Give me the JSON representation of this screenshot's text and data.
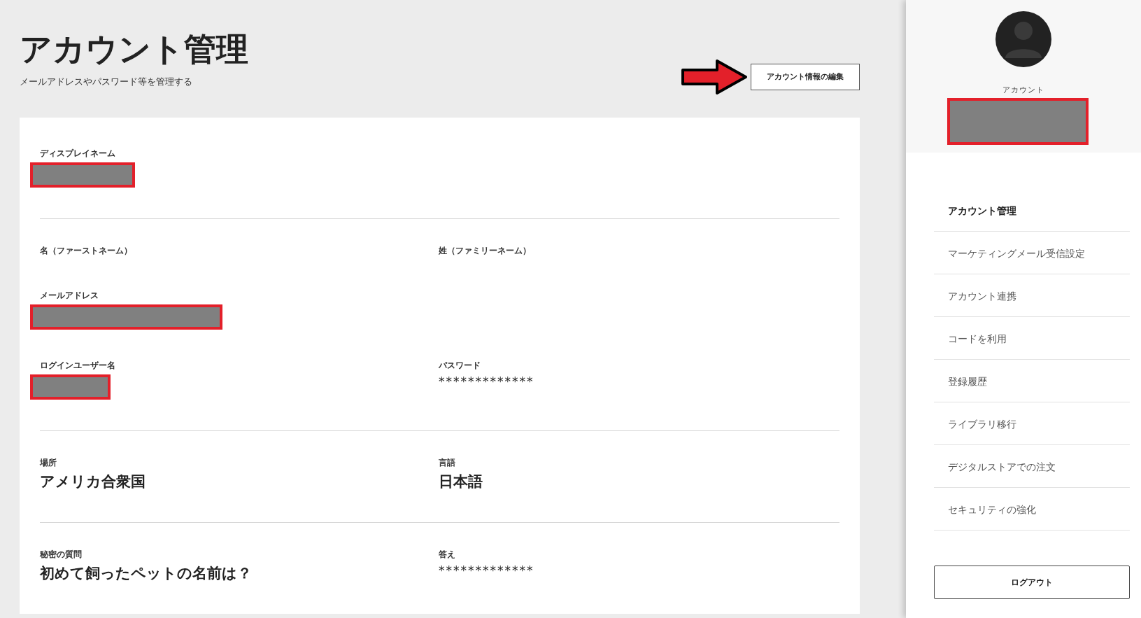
{
  "header": {
    "title": "アカウント管理",
    "subtitle": "メールアドレスやパスワード等を管理する"
  },
  "edit_button": {
    "label": "アカウント情報の編集"
  },
  "sections": [
    {
      "rows": [
        [
          {
            "label": "ディスプレイネーム",
            "kind": "redacted"
          }
        ]
      ]
    },
    {
      "rows": [
        [
          {
            "label": "名（ファーストネーム）",
            "kind": "empty"
          },
          {
            "label": "姓（ファミリーネーム）",
            "kind": "empty"
          }
        ],
        [
          {
            "label": "メールアドレス",
            "kind": "redacted"
          }
        ],
        [
          {
            "label": "ログインユーザー名",
            "kind": "redacted"
          },
          {
            "label": "パスワード",
            "kind": "masked",
            "value": "*************"
          }
        ]
      ]
    },
    {
      "rows": [
        [
          {
            "label": "場所",
            "kind": "text",
            "value": "アメリカ合衆国"
          },
          {
            "label": "言語",
            "kind": "text",
            "value": "日本語"
          }
        ]
      ]
    },
    {
      "rows": [
        [
          {
            "label": "秘密の質問",
            "kind": "text",
            "value": "初めて飼ったペットの名前は？"
          },
          {
            "label": "答え",
            "kind": "masked",
            "value": "*************"
          }
        ]
      ]
    }
  ],
  "sidebar": {
    "account_label": "アカウント",
    "account_redacted": true,
    "items": [
      {
        "label": "アカウント管理",
        "selected": true
      },
      {
        "label": "マーケティングメール受信設定",
        "selected": false
      },
      {
        "label": "アカウント連携",
        "selected": false
      },
      {
        "label": "コードを利用",
        "selected": false
      },
      {
        "label": "登録履歴",
        "selected": false
      },
      {
        "label": "ライブラリ移行",
        "selected": false
      },
      {
        "label": "デジタルストアでの注文",
        "selected": false
      },
      {
        "label": "セキュリティの強化",
        "selected": false
      }
    ],
    "logout_button": {
      "label": "ログアウト"
    }
  }
}
